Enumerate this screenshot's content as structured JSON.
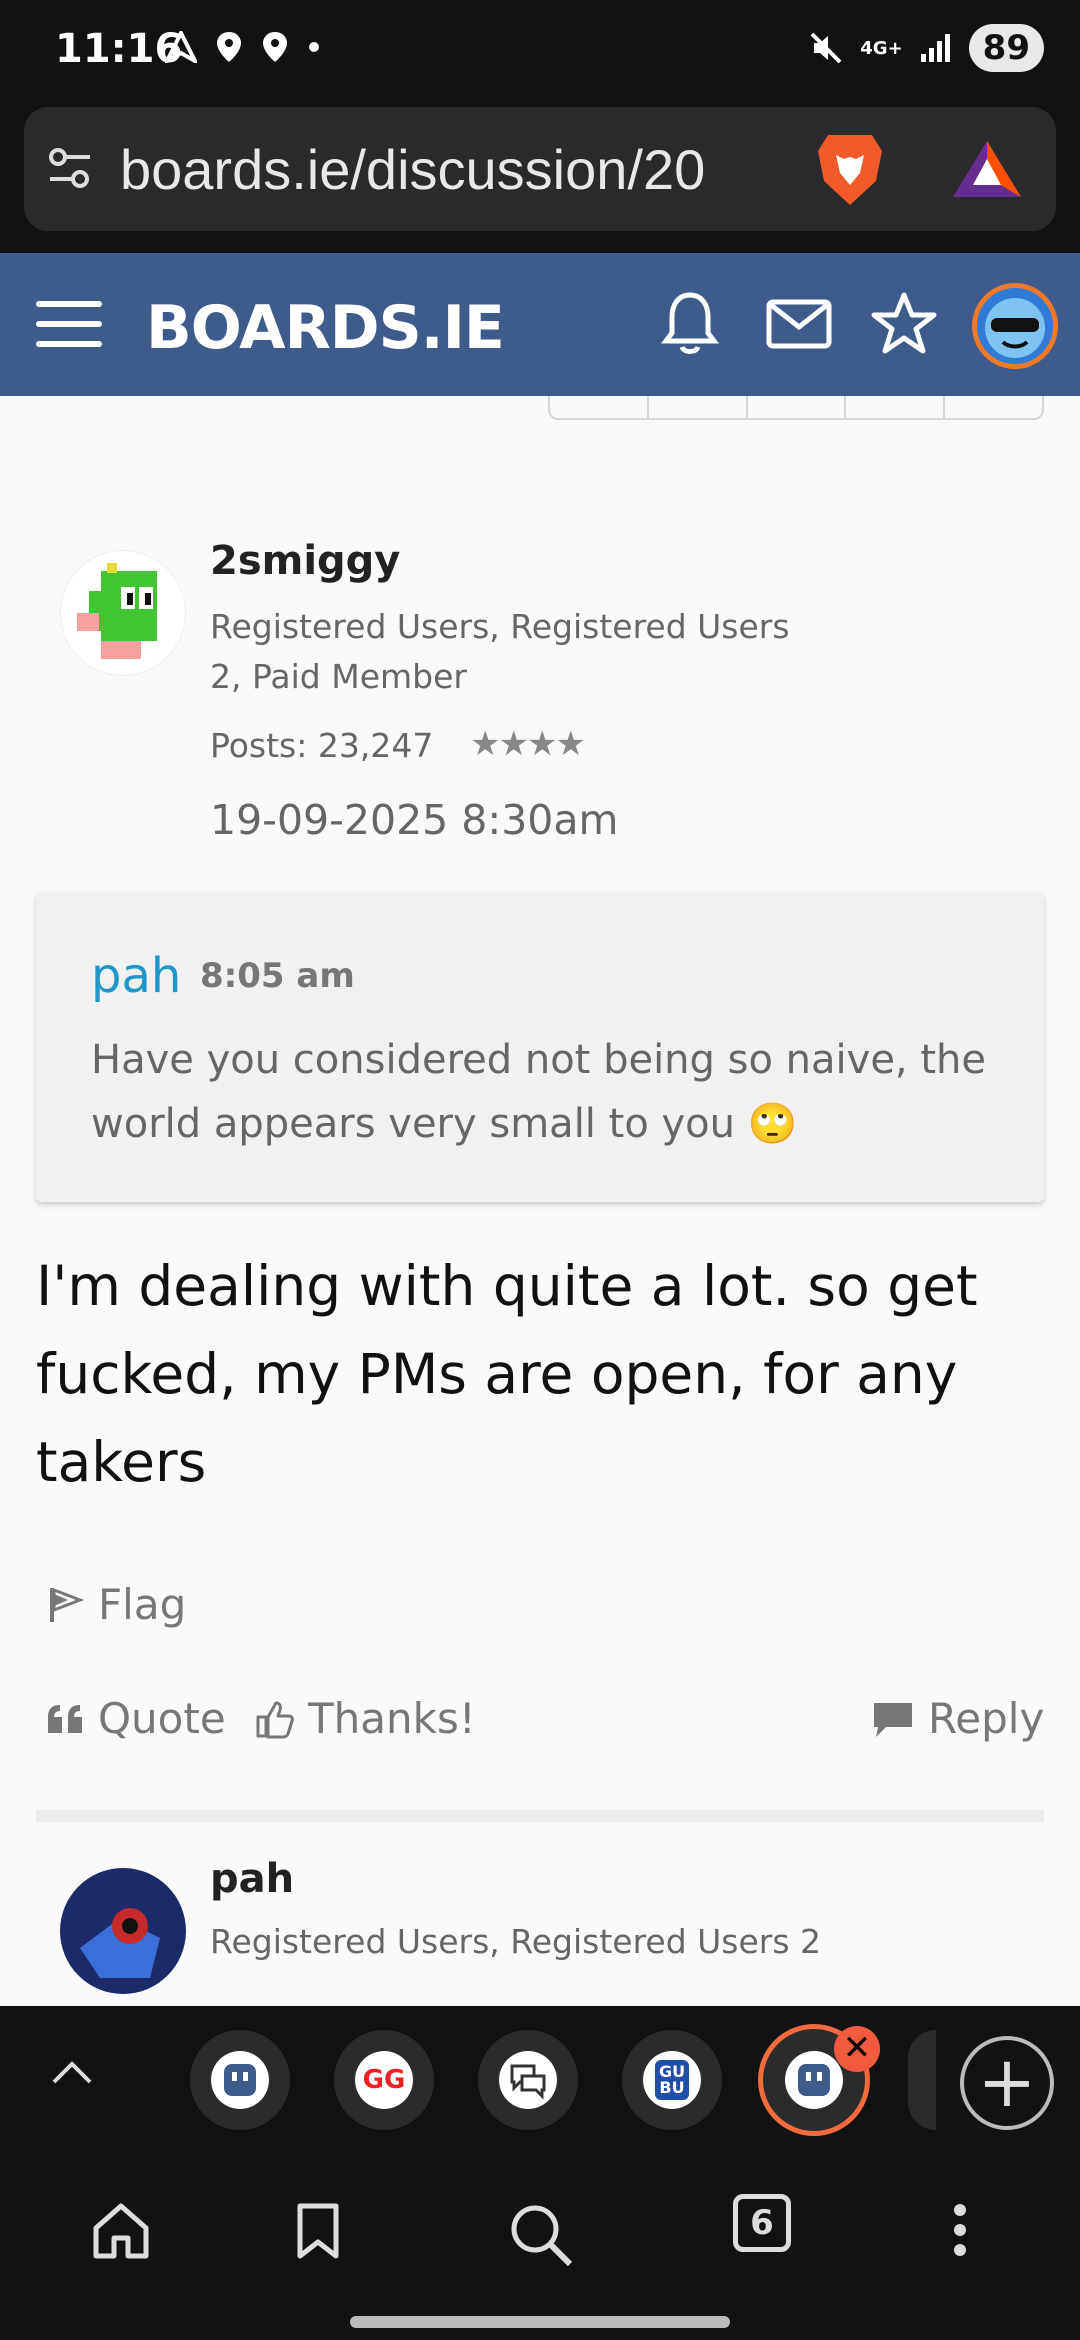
{
  "status_bar": {
    "time": "11:16",
    "network": "4G+",
    "battery": "89"
  },
  "browser": {
    "url": "boards.ie/discussion/20",
    "tab_count": "6",
    "add_tab": "+",
    "close_tab": "✕"
  },
  "site": {
    "logo": "BOARDS.IE"
  },
  "post": {
    "username": "2smiggy",
    "roles": "Registered Users, Registered Users 2, Paid Member",
    "posts_count": "Posts: 23,247",
    "stars": "★★★★",
    "date": "19-09-2025 8:30am",
    "quote": {
      "user": "pah",
      "time": "8:05 am",
      "text": "Have you considered not being so naive, the world appears very small to you 🙄"
    },
    "body": "I'm dealing with quite a lot. so get fucked, my PMs are open, for any takers",
    "actions": {
      "flag": "Flag",
      "quote": "Quote",
      "thanks": "Thanks!",
      "reply": "Reply"
    }
  },
  "next_post": {
    "username": "pah",
    "roles": "Registered Users, Registered Users 2"
  },
  "colors": {
    "header_bg": "#3e5b8c",
    "quote_user": "#2196c8",
    "active_tab_ring": "#f36a3d"
  }
}
